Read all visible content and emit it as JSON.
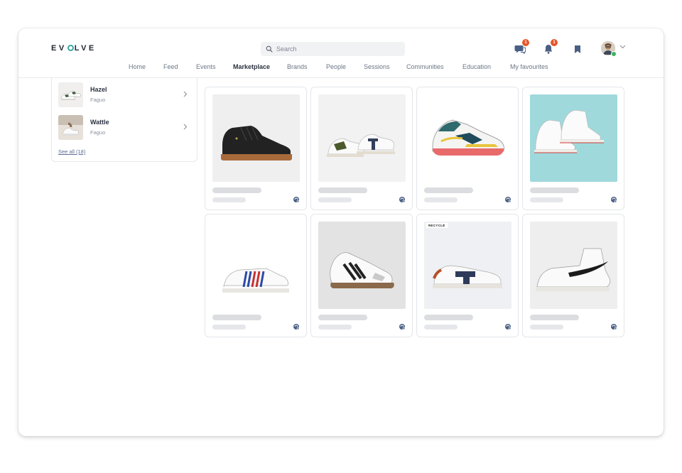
{
  "brand": {
    "logo_text_1": "EV",
    "logo_text_2": "LVE"
  },
  "search": {
    "placeholder": "Search"
  },
  "header": {
    "messages_badge": "1",
    "notifications_badge": "1"
  },
  "nav": {
    "items": [
      "Home",
      "Feed",
      "Events",
      "Marketplace",
      "Brands",
      "People",
      "Sessions",
      "Communities",
      "Education",
      "My favourites"
    ],
    "active": "Marketplace"
  },
  "sidebar": {
    "items": [
      {
        "title": "Hazel",
        "brand": "Faguo"
      },
      {
        "title": "Wattle",
        "brand": "Faguo"
      }
    ],
    "see_all": "See all (18)"
  },
  "products": [
    {
      "image": "black-leather-high-top-sneaker",
      "tag": ""
    },
    {
      "image": "white-green-faguo-sneakers",
      "tag": ""
    },
    {
      "image": "nike-air-max-270-react",
      "tag": ""
    },
    {
      "image": "white-converse-high-tops",
      "tag": ""
    },
    {
      "image": "white-sneaker-blue-red-stripes",
      "tag": ""
    },
    {
      "image": "adidas-samba-white-black",
      "tag": ""
    },
    {
      "image": "faguo-recycled-sneaker",
      "tag": "RECYCLÉ"
    },
    {
      "image": "nike-blazer-mid-white",
      "tag": ""
    }
  ],
  "colors": {
    "accent": "#3aa6a0",
    "badge": "#e8542a",
    "online": "#3bb463",
    "nav_inactive": "#6b7787"
  }
}
